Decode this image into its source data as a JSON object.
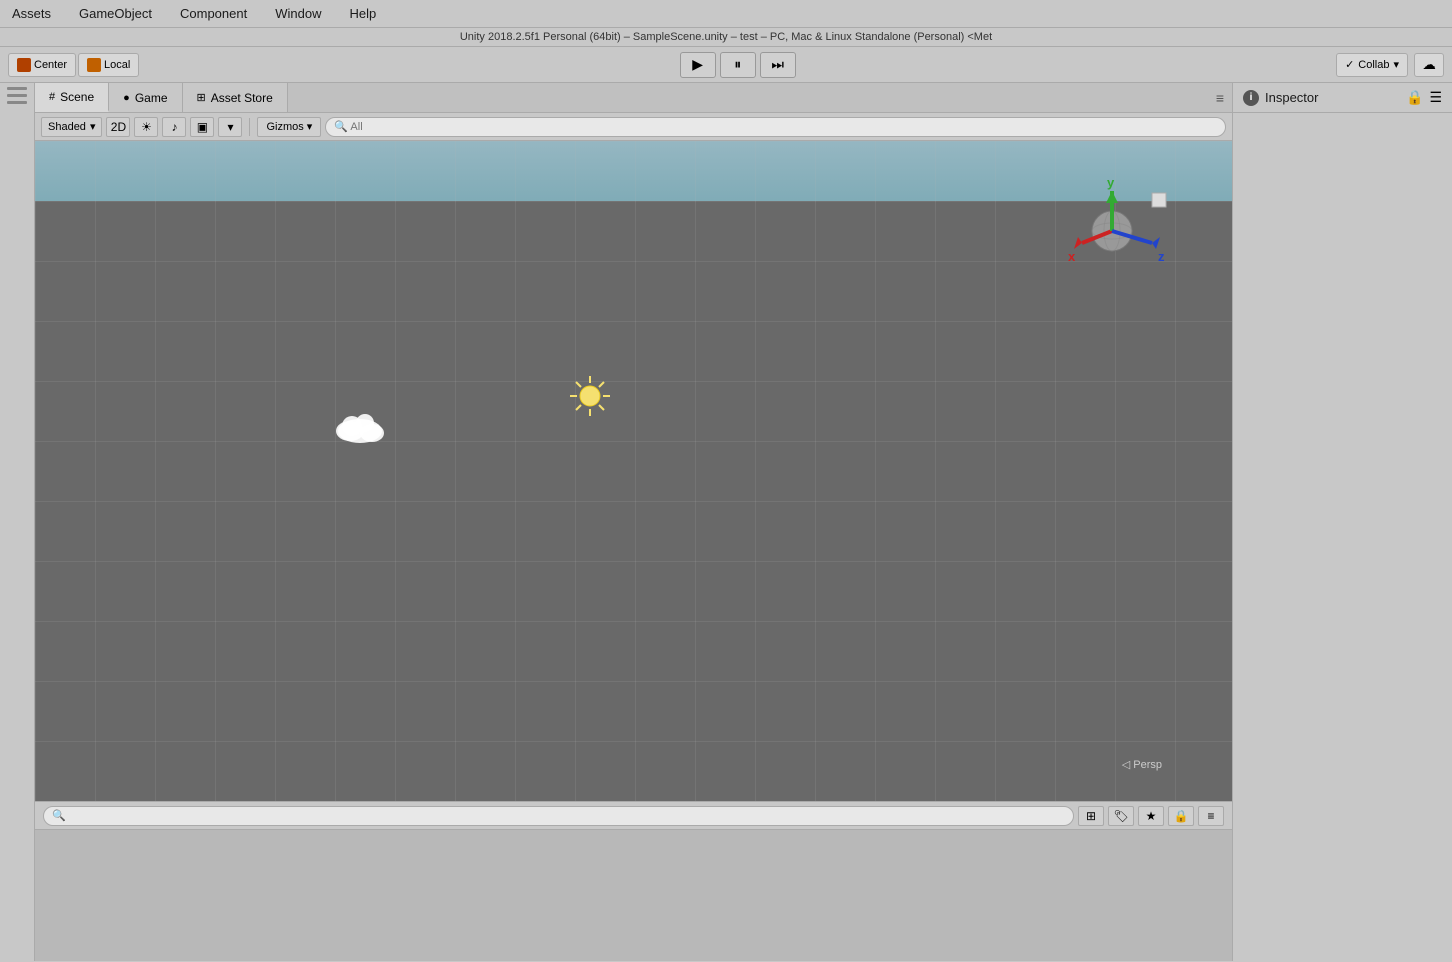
{
  "menubar": {
    "items": [
      "Assets",
      "GameObject",
      "Component",
      "Window",
      "Help"
    ]
  },
  "titlebar": {
    "text": "Unity 2018.2.5f1 Personal (64bit) – SampleScene.unity – test – PC, Mac & Linux Standalone (Personal) <Met"
  },
  "toolbar": {
    "center_btn_label": "Center",
    "local_btn_label": "Local",
    "play_btn": "▶",
    "pause_btn": "⏸",
    "step_btn": "⏭",
    "collab_btn": "Collab",
    "collab_check": "✓"
  },
  "tabs": [
    {
      "label": "Scene",
      "icon": "#",
      "active": true
    },
    {
      "label": "Game",
      "icon": "●"
    },
    {
      "label": "Asset Store",
      "icon": "⊞"
    }
  ],
  "scene_toolbar": {
    "shading_mode": "Shaded",
    "shading_arrow": "▾",
    "btn_2d": "2D",
    "btn_sun": "☀",
    "btn_audio": "♪",
    "btn_image": "▣",
    "btn_more": "▾",
    "gizmos_label": "Gizmos",
    "gizmos_arrow": "▾",
    "search_placeholder": "All"
  },
  "scene_view": {
    "bg_color": "#696969",
    "sky_color": "#a8d8e8",
    "sun_symbol": "✦",
    "cloud_symbol": "☁",
    "persp_label": "◁ Persp",
    "gizmo": {
      "x_color": "#cc2222",
      "y_color": "#33aa33",
      "z_color": "#2244cc",
      "x_label": "x",
      "y_label": "y",
      "z_label": "z"
    }
  },
  "bottom_panel": {
    "search_placeholder": "🔍"
  },
  "inspector": {
    "title": "Inspector",
    "info_icon": "i",
    "lock_icon": "🔒",
    "menu_icon": "☰"
  }
}
